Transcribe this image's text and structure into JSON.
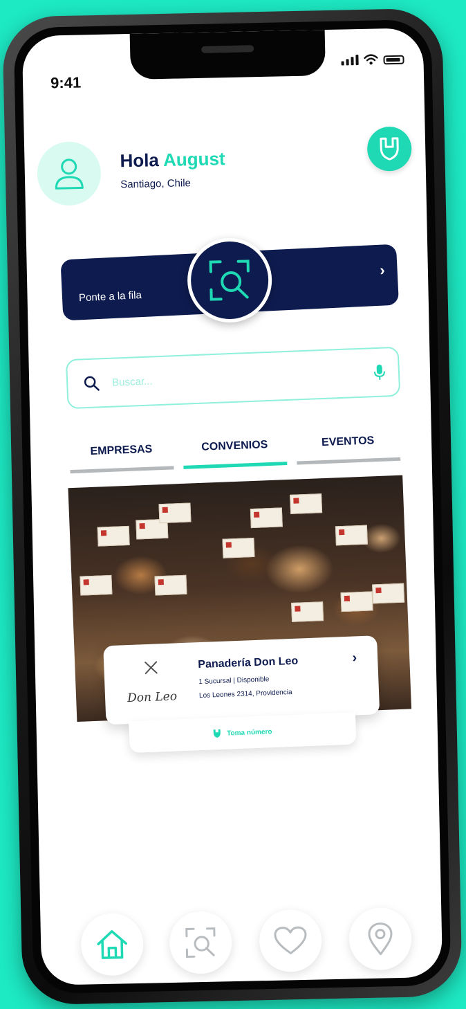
{
  "status_bar": {
    "time": "9:41"
  },
  "header": {
    "greeting_prefix": "Hola",
    "user_name": "August",
    "location": "Santiago, Chile"
  },
  "queue": {
    "label": "Ponte a la fila",
    "chevron": "›"
  },
  "search": {
    "placeholder": "Buscar..."
  },
  "tabs": [
    {
      "label": "EMPRESAS",
      "active": false
    },
    {
      "label": "CONVENIOS",
      "active": true
    },
    {
      "label": "EVENTOS",
      "active": false
    }
  ],
  "card": {
    "logo_text": "Don Leo",
    "name": "Panadería Don Leo",
    "status": "1 Sucursal | Disponible",
    "address": "Los Leones 2314, Providencia",
    "chevron": "›",
    "take_number": "Toma número"
  },
  "bottom_nav": [
    "home-icon",
    "scan-search-icon",
    "heart-icon",
    "location-pin-icon"
  ],
  "colors": {
    "accent": "#1fd9b4",
    "navy": "#0d1b4f",
    "background": "#1de9c3"
  }
}
